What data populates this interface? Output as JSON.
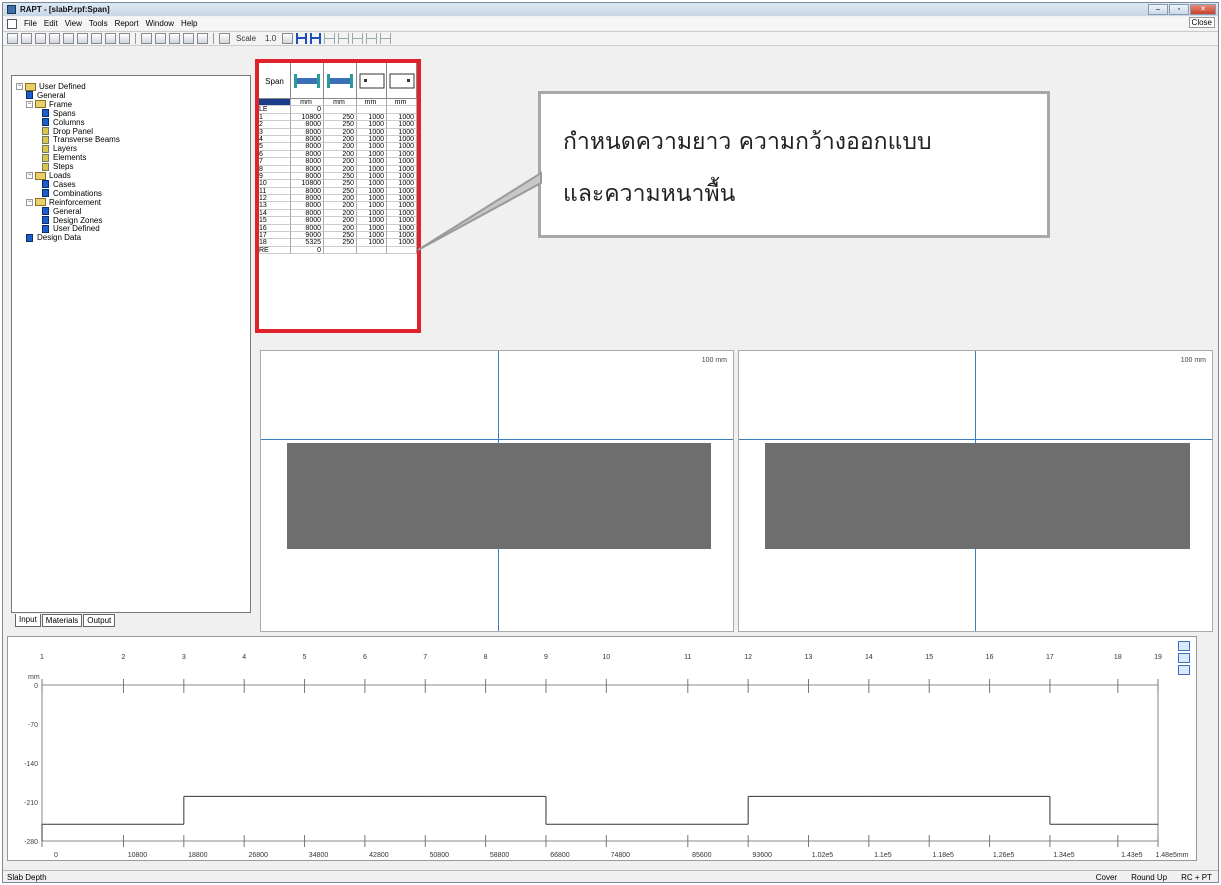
{
  "window": {
    "title": "RAPT - [slabP.rpf:Span]",
    "close_tip": "Close",
    "minimize": "–",
    "restore": "▫",
    "close": "✕"
  },
  "menu": [
    "File",
    "Edit",
    "View",
    "Tools",
    "Report",
    "Window",
    "Help"
  ],
  "toolbar": {
    "scale_label": "Scale",
    "scale_value": "1.0"
  },
  "tree": [
    {
      "label": "User Defined",
      "level": 0,
      "icon": "folder-icon",
      "expander": "−"
    },
    {
      "label": "General",
      "level": 1,
      "icon": "doc-icon"
    },
    {
      "label": "Frame",
      "level": 1,
      "icon": "folder-icon",
      "expander": "−"
    },
    {
      "label": "Spans",
      "level": 2,
      "icon": "doc-icon"
    },
    {
      "label": "Columns",
      "level": 2,
      "icon": "doc-icon"
    },
    {
      "label": "Drop Panel",
      "level": 2,
      "icon": "doc-yellow-icon"
    },
    {
      "label": "Transverse Beams",
      "level": 2,
      "icon": "doc-yellow-icon"
    },
    {
      "label": "Layers",
      "level": 2,
      "icon": "doc-yellow-icon"
    },
    {
      "label": "Elements",
      "level": 2,
      "icon": "doc-yellow-icon"
    },
    {
      "label": "Steps",
      "level": 2,
      "icon": "doc-yellow-icon"
    },
    {
      "label": "Loads",
      "level": 1,
      "icon": "folder-icon",
      "expander": "−"
    },
    {
      "label": "Cases",
      "level": 2,
      "icon": "doc-icon"
    },
    {
      "label": "Combinations",
      "level": 2,
      "icon": "doc-icon"
    },
    {
      "label": "Reinforcement",
      "level": 1,
      "icon": "folder-icon",
      "expander": "−"
    },
    {
      "label": "General",
      "level": 2,
      "icon": "doc-icon"
    },
    {
      "label": "Design Zones",
      "level": 2,
      "icon": "doc-icon"
    },
    {
      "label": "User Defined",
      "level": 2,
      "icon": "doc-icon"
    },
    {
      "label": "Design Data",
      "level": 1,
      "icon": "doc-icon"
    }
  ],
  "bottom_tabs": [
    "Input",
    "Materials",
    "Output"
  ],
  "span_table": {
    "header": "Span",
    "units": [
      "",
      "mm",
      "mm",
      "mm",
      "mm"
    ],
    "rows": [
      [
        "LE",
        "0",
        "",
        "",
        ""
      ],
      [
        "1",
        "10800",
        "250",
        "1000",
        "1000"
      ],
      [
        "2",
        "8000",
        "250",
        "1000",
        "1000"
      ],
      [
        "3",
        "8000",
        "200",
        "1000",
        "1000"
      ],
      [
        "4",
        "8000",
        "200",
        "1000",
        "1000"
      ],
      [
        "5",
        "8000",
        "200",
        "1000",
        "1000"
      ],
      [
        "6",
        "8000",
        "200",
        "1000",
        "1000"
      ],
      [
        "7",
        "8000",
        "200",
        "1000",
        "1000"
      ],
      [
        "8",
        "8000",
        "200",
        "1000",
        "1000"
      ],
      [
        "9",
        "8000",
        "250",
        "1000",
        "1000"
      ],
      [
        "10",
        "10800",
        "250",
        "1000",
        "1000"
      ],
      [
        "11",
        "8000",
        "250",
        "1000",
        "1000"
      ],
      [
        "12",
        "8000",
        "200",
        "1000",
        "1000"
      ],
      [
        "13",
        "8000",
        "200",
        "1000",
        "1000"
      ],
      [
        "14",
        "8000",
        "200",
        "1000",
        "1000"
      ],
      [
        "15",
        "8000",
        "200",
        "1000",
        "1000"
      ],
      [
        "16",
        "8000",
        "200",
        "1000",
        "1000"
      ],
      [
        "17",
        "9000",
        "250",
        "1000",
        "1000"
      ],
      [
        "18",
        "5325",
        "250",
        "1000",
        "1000"
      ],
      [
        "RE",
        "0",
        "",
        "",
        ""
      ]
    ]
  },
  "callout": {
    "line1": "กำหนดความยาว ความกว้างออกแบบ",
    "line2": "และความหนาพื้น"
  },
  "elevation_left": {
    "scale": "100 mm"
  },
  "elevation_right": {
    "scale": "100 mm"
  },
  "chart_data": {
    "type": "line",
    "title": "",
    "ylabel": "mm",
    "xlabel": "",
    "y_ticks": [
      "0",
      "-70",
      "-140",
      "-210",
      "-280"
    ],
    "ylim": [
      -280,
      0
    ],
    "support_labels": [
      "1",
      "2",
      "3",
      "4",
      "5",
      "6",
      "7",
      "8",
      "9",
      "10",
      "11",
      "12",
      "13",
      "14",
      "15",
      "16",
      "17",
      "18",
      "19"
    ],
    "x_tick_labels": [
      "0",
      "10800",
      "18800",
      "26800",
      "34800",
      "42800",
      "50800",
      "58800",
      "66800",
      "74800",
      "85600",
      "93600",
      "1.02e5",
      "1.1e5",
      "1.18e5",
      "1.26e5",
      "1.34e5",
      "1.43e5",
      "1.48e5mm"
    ],
    "x_positions": [
      0,
      10800,
      18800,
      26800,
      34800,
      42800,
      50800,
      58800,
      66800,
      74800,
      85600,
      93600,
      101600,
      109600,
      117600,
      125600,
      133600,
      142600,
      147925
    ],
    "series": [
      {
        "values": [
          -250,
          -250,
          -200,
          -200,
          -200,
          -200,
          -200,
          -200,
          -250,
          -250,
          -250,
          -200,
          -200,
          -200,
          -200,
          -200,
          -250,
          -250
        ]
      }
    ],
    "xlim": [
      0,
      147925
    ]
  },
  "status": {
    "left": "Slab Depth",
    "cover": "Cover",
    "round": "Round Up",
    "mode": "RC + PT"
  }
}
